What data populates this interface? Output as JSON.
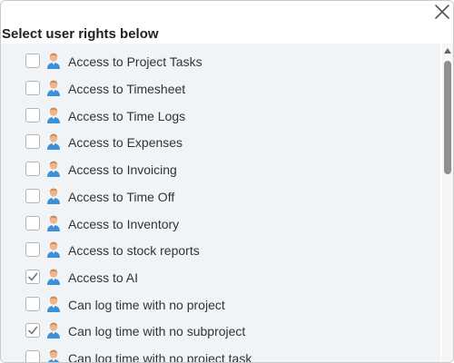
{
  "dialog": {
    "title": "Select user rights below",
    "close_icon": "close-icon",
    "item_icon": "user-icon"
  },
  "rights": [
    {
      "label": "Access to Project Tasks",
      "checked": false
    },
    {
      "label": "Access to Timesheet",
      "checked": false
    },
    {
      "label": "Access to Time Logs",
      "checked": false
    },
    {
      "label": "Access to Expenses",
      "checked": false
    },
    {
      "label": "Access to Invoicing",
      "checked": false
    },
    {
      "label": "Access to Time Off",
      "checked": false
    },
    {
      "label": "Access to Inventory",
      "checked": false
    },
    {
      "label": "Access to stock reports",
      "checked": false
    },
    {
      "label": "Access to AI",
      "checked": true
    },
    {
      "label": "Can log time with no project",
      "checked": false
    },
    {
      "label": "Can log time with no subproject",
      "checked": true
    },
    {
      "label": "Can log time with no project task",
      "checked": false
    }
  ],
  "colors": {
    "list_background": "#f1f4f6",
    "check_mark": "#777777",
    "icon_skin": "#f2b48a",
    "icon_shirt": "#3d8fd6"
  }
}
